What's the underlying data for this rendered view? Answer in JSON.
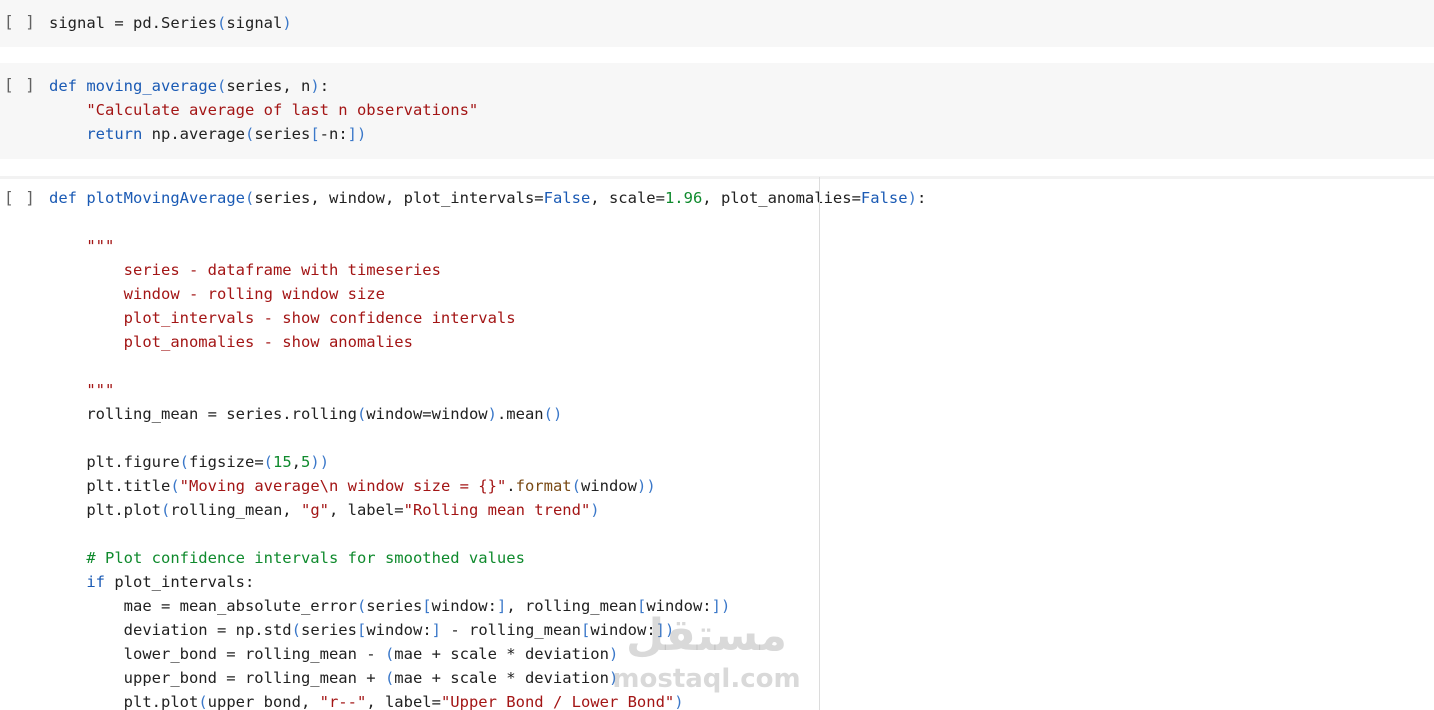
{
  "cells": [
    {
      "prompt": "[ ]",
      "lines": [
        [
          [
            "",
            "signal = pd.Series"
          ],
          [
            "b",
            "("
          ],
          [
            "",
            "signal"
          ],
          [
            "b",
            ")"
          ]
        ]
      ]
    },
    {
      "prompt": "[ ]",
      "lines": [
        [
          [
            "k",
            "def"
          ],
          [
            "",
            " "
          ],
          [
            "k",
            "moving_average"
          ],
          [
            "b",
            "("
          ],
          [
            "",
            "series, n"
          ],
          [
            "b",
            ")"
          ],
          [
            "",
            ":"
          ]
        ],
        [
          [
            "",
            "    "
          ],
          [
            "s",
            "\"Calculate average of last n observations\""
          ]
        ],
        [
          [
            "",
            "    "
          ],
          [
            "k",
            "return"
          ],
          [
            "",
            " np.average"
          ],
          [
            "b",
            "("
          ],
          [
            "",
            "series"
          ],
          [
            "b",
            "["
          ],
          [
            "",
            "-n:"
          ],
          [
            "b",
            "]"
          ],
          [
            "b",
            ")"
          ]
        ]
      ]
    },
    {
      "prompt": "[ ]",
      "lines": [
        [
          [
            "k",
            "def"
          ],
          [
            "",
            " "
          ],
          [
            "k",
            "plotMovingAverage"
          ],
          [
            "b",
            "("
          ],
          [
            "",
            "series, window, plot_intervals="
          ],
          [
            "k",
            "False"
          ],
          [
            "",
            ", scale="
          ],
          [
            "n",
            "1.96"
          ],
          [
            "",
            ", plot_anomalies="
          ],
          [
            "k",
            "False"
          ],
          [
            "b",
            ")"
          ],
          [
            "",
            ":"
          ]
        ],
        [],
        [
          [
            "",
            "    "
          ],
          [
            "s",
            "\"\"\""
          ]
        ],
        [
          [
            "",
            "        "
          ],
          [
            "s",
            "series - dataframe with timeseries"
          ]
        ],
        [
          [
            "",
            "        "
          ],
          [
            "s",
            "window - rolling window size"
          ]
        ],
        [
          [
            "",
            "        "
          ],
          [
            "s",
            "plot_intervals - show confidence intervals"
          ]
        ],
        [
          [
            "",
            "        "
          ],
          [
            "s",
            "plot_anomalies - show anomalies"
          ]
        ],
        [],
        [
          [
            "",
            "    "
          ],
          [
            "s",
            "\"\"\""
          ]
        ],
        [
          [
            "",
            "    rolling_mean = series.rolling"
          ],
          [
            "b",
            "("
          ],
          [
            "",
            "window=window"
          ],
          [
            "b",
            ")"
          ],
          [
            "",
            ".mean"
          ],
          [
            "b",
            "()"
          ]
        ],
        [],
        [
          [
            "",
            "    plt.figure"
          ],
          [
            "b",
            "("
          ],
          [
            "",
            "figsize="
          ],
          [
            "b",
            "("
          ],
          [
            "n",
            "15"
          ],
          [
            "",
            ","
          ],
          [
            "n",
            "5"
          ],
          [
            "b",
            ")"
          ],
          [
            "b",
            ")"
          ]
        ],
        [
          [
            "",
            "    plt.title"
          ],
          [
            "b",
            "("
          ],
          [
            "s",
            "\"Moving average\\n window size = {}\""
          ],
          [
            "",
            "."
          ],
          [
            "f",
            "format"
          ],
          [
            "b",
            "("
          ],
          [
            "",
            "window"
          ],
          [
            "b",
            ")"
          ],
          [
            "b",
            ")"
          ]
        ],
        [
          [
            "",
            "    plt.plot"
          ],
          [
            "b",
            "("
          ],
          [
            "",
            "rolling_mean, "
          ],
          [
            "s",
            "\"g\""
          ],
          [
            "",
            ", label="
          ],
          [
            "s",
            "\"Rolling mean trend\""
          ],
          [
            "b",
            ")"
          ]
        ],
        [],
        [
          [
            "",
            "    "
          ],
          [
            "n",
            "# Plot confidence intervals for smoothed values"
          ]
        ],
        [
          [
            "",
            "    "
          ],
          [
            "k",
            "if"
          ],
          [
            "",
            " plot_intervals:"
          ]
        ],
        [
          [
            "",
            "        mae = mean_absolute_error"
          ],
          [
            "b",
            "("
          ],
          [
            "",
            "series"
          ],
          [
            "b",
            "["
          ],
          [
            "",
            "window:"
          ],
          [
            "b",
            "]"
          ],
          [
            "",
            ", rolling_mean"
          ],
          [
            "b",
            "["
          ],
          [
            "",
            "window:"
          ],
          [
            "b",
            "]"
          ],
          [
            "b",
            ")"
          ]
        ],
        [
          [
            "",
            "        deviation = np.std"
          ],
          [
            "b",
            "("
          ],
          [
            "",
            "series"
          ],
          [
            "b",
            "["
          ],
          [
            "",
            "window:"
          ],
          [
            "b",
            "]"
          ],
          [
            "",
            " - rolling_mean"
          ],
          [
            "b",
            "["
          ],
          [
            "",
            "window:"
          ],
          [
            "b",
            "]"
          ],
          [
            "b",
            ")"
          ]
        ],
        [
          [
            "",
            "        lower_bond = rolling_mean - "
          ],
          [
            "b",
            "("
          ],
          [
            "",
            "mae + scale * deviation"
          ],
          [
            "b",
            ")"
          ]
        ],
        [
          [
            "",
            "        upper_bond = rolling_mean + "
          ],
          [
            "b",
            "("
          ],
          [
            "",
            "mae + scale * deviation"
          ],
          [
            "b",
            ")"
          ]
        ],
        [
          [
            "",
            "        plt.plot"
          ],
          [
            "b",
            "("
          ],
          [
            "",
            "upper_bond, "
          ],
          [
            "s",
            "\"r--\""
          ],
          [
            "",
            ", label="
          ],
          [
            "s",
            "\"Upper Bond / Lower Bond\""
          ],
          [
            "b",
            ")"
          ]
        ]
      ]
    }
  ],
  "watermark": {
    "logo": "مستقل",
    "url": "mostaql.com"
  },
  "colors": {
    "keyword": "#1a5ab4",
    "string": "#a31515",
    "number": "#0f8a2d",
    "bracket": "#3b78c9",
    "cell_background": "#f7f7f7"
  }
}
